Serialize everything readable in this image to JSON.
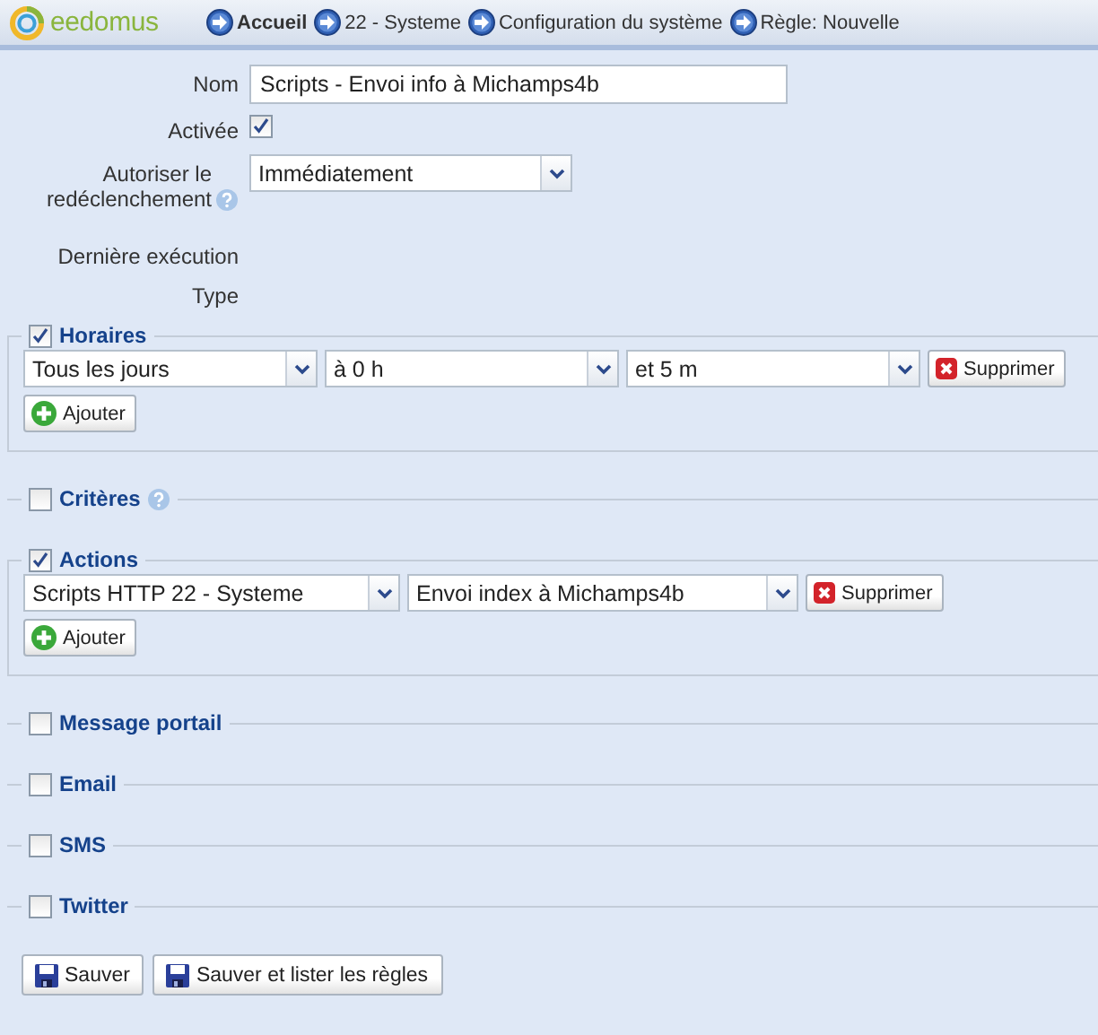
{
  "header": {
    "logo": "eedomus",
    "breadcrumbs": [
      {
        "label": "Accueil",
        "kind": "home"
      },
      {
        "label": "22 - Systeme",
        "kind": "page"
      },
      {
        "label": "Configuration du système",
        "kind": "page"
      },
      {
        "label": "Règle: Nouvelle",
        "kind": "page"
      }
    ]
  },
  "form": [
    {
      "label": "Nom",
      "kind": "text",
      "value": "Scripts - Envoi info à Michamps4b"
    },
    {
      "label": "Activée",
      "kind": "checkbox",
      "checked": true
    },
    {
      "label": "Autoriser le redéclenchement",
      "kind": "select",
      "value": "Immédiatement",
      "help": true
    },
    {
      "label": "Dernière exécution",
      "kind": "info"
    },
    {
      "label": "Type",
      "kind": "info"
    }
  ],
  "sections": [
    {
      "title": "Horaires",
      "checked": true,
      "rows": [
        {
          "selects": [
            "Tous les jours",
            "à 0 h",
            "et 5 m"
          ],
          "remove": "Supprimer"
        }
      ],
      "add": "Ajouter"
    },
    {
      "title": "Critères",
      "checked": false,
      "help": true
    },
    {
      "title": "Actions",
      "checked": true,
      "rows": [
        {
          "selects": [
            "Scripts HTTP 22 - Systeme",
            "Envoi index à Michamps4b"
          ],
          "remove": "Supprimer"
        }
      ],
      "add": "Ajouter"
    },
    {
      "title": "Message portail",
      "checked": false
    },
    {
      "title": "Email",
      "checked": false
    },
    {
      "title": "SMS",
      "checked": false
    },
    {
      "title": "Twitter",
      "checked": false
    }
  ],
  "buttons": [
    {
      "label": "Sauver"
    },
    {
      "label": "Sauver et lister les règles"
    }
  ]
}
